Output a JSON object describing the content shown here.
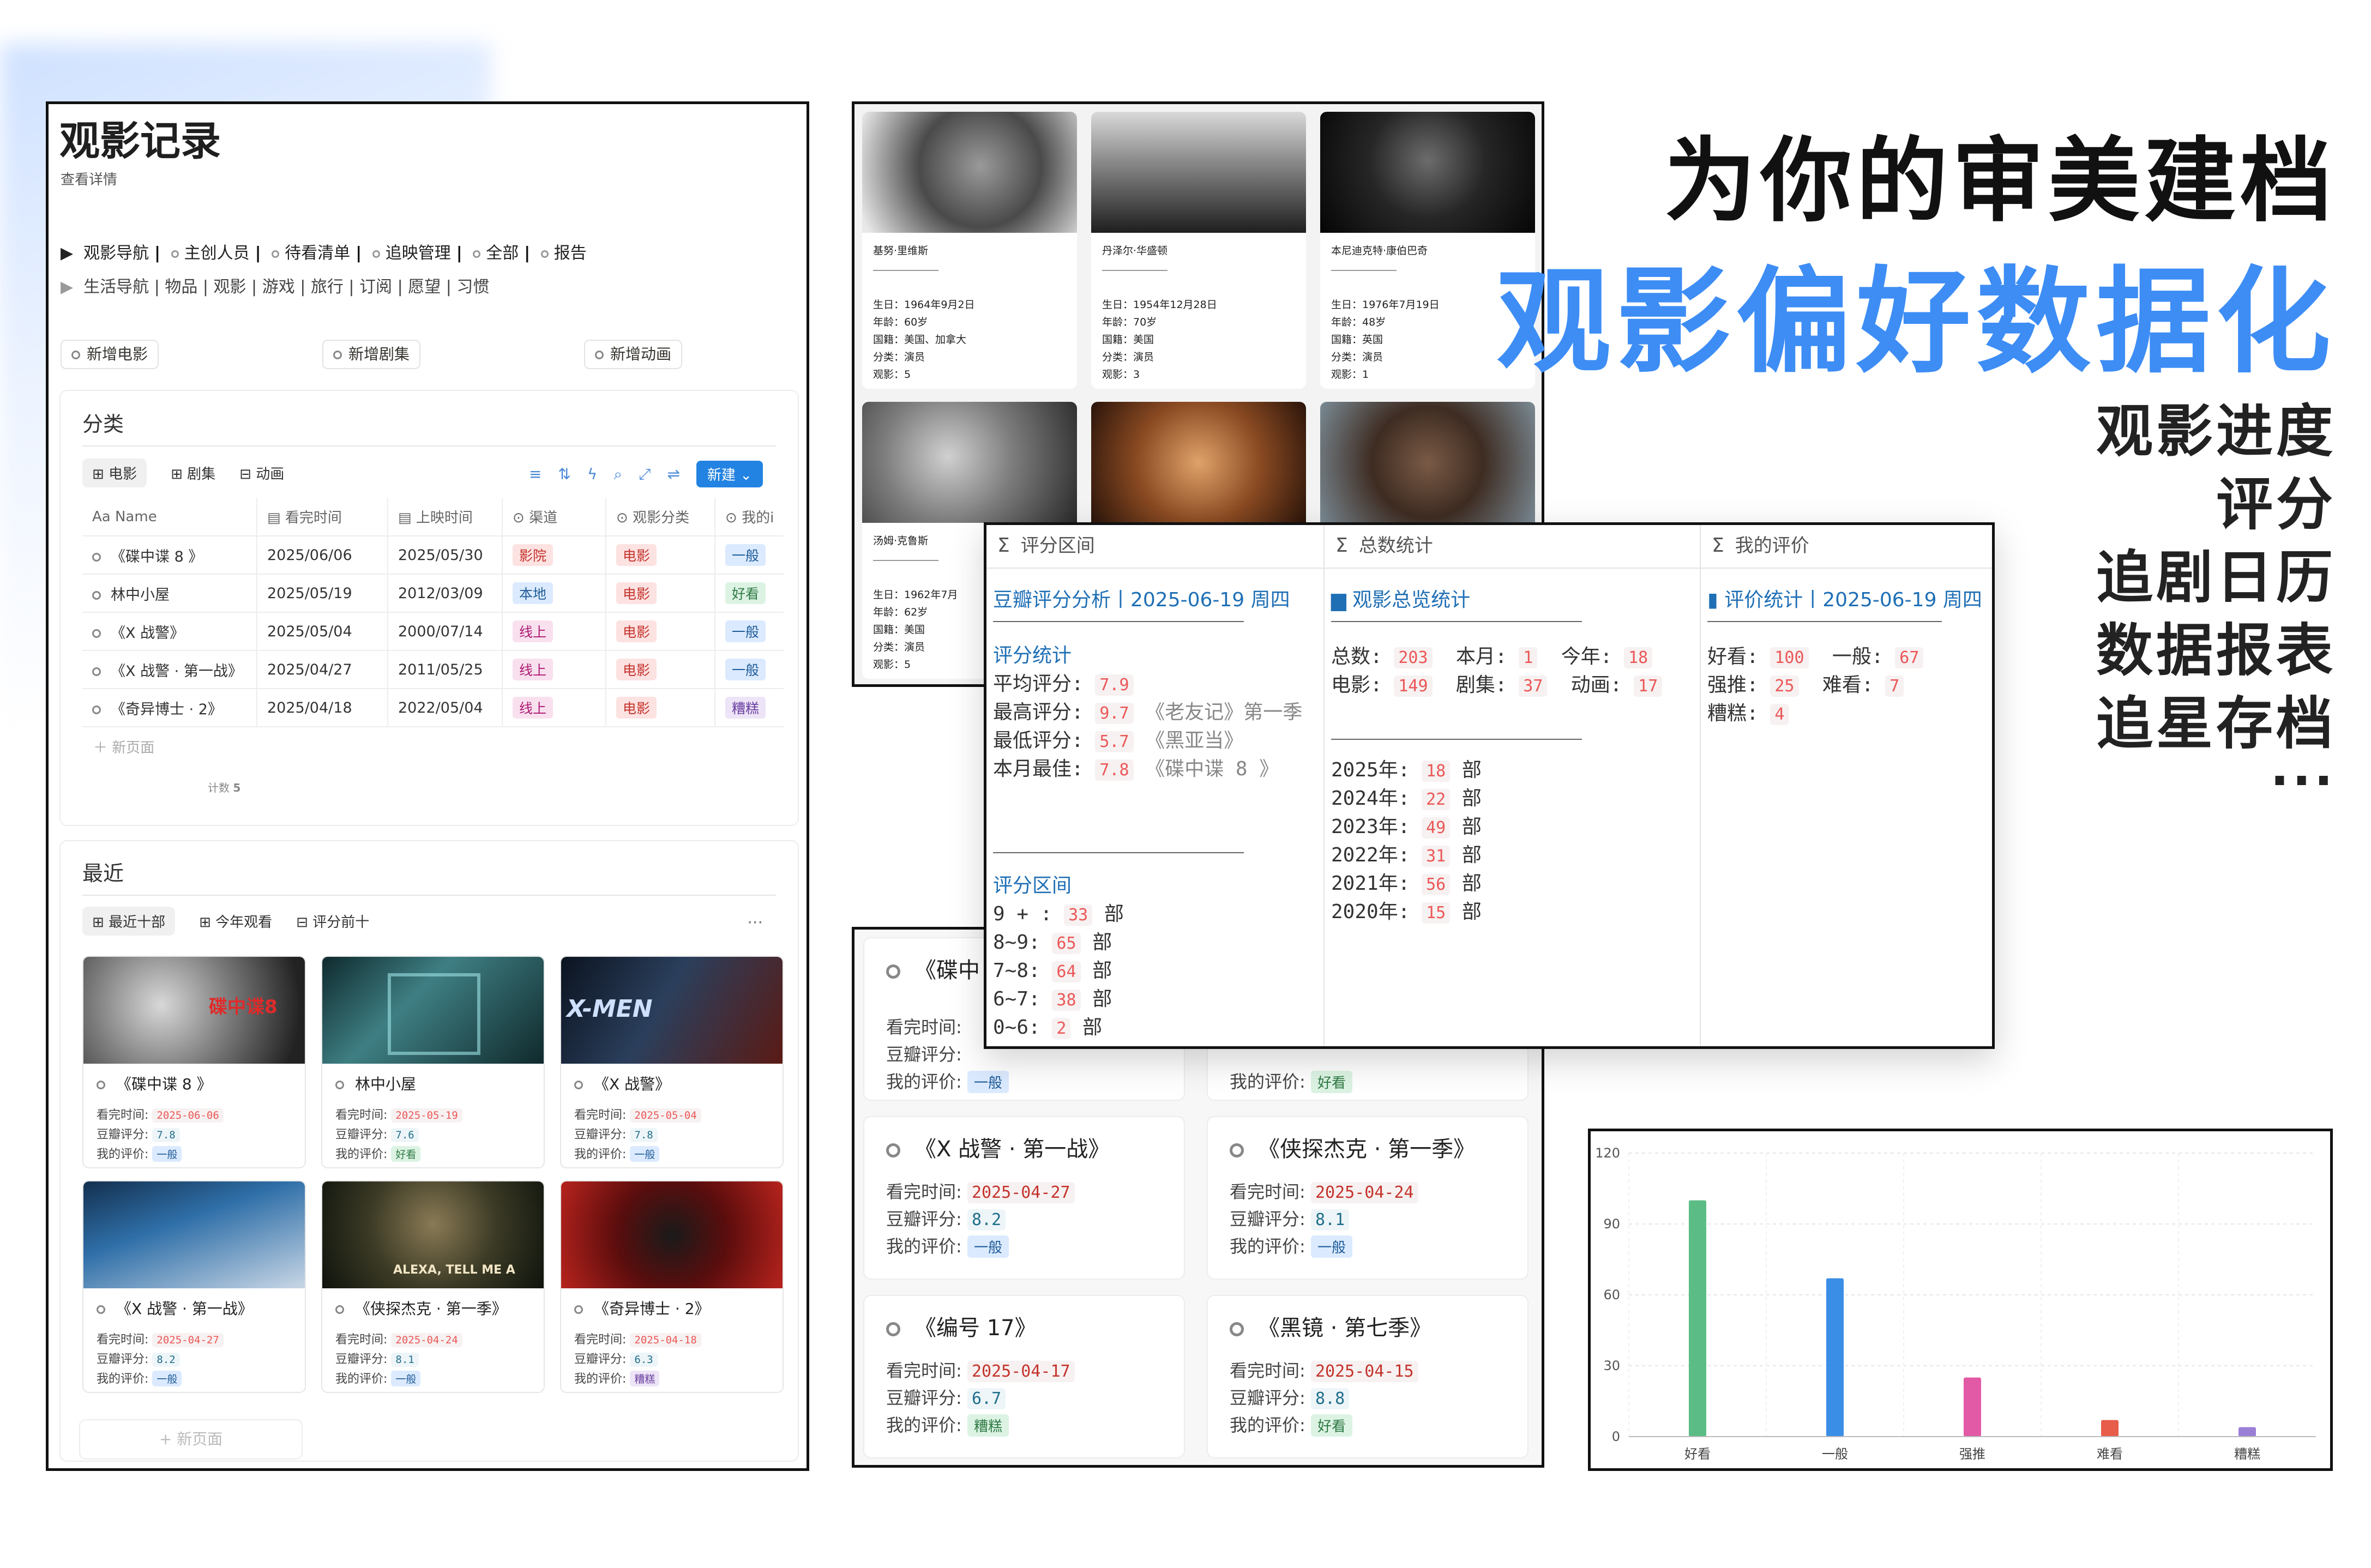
{
  "headline": {
    "line1": "为你的审美建档",
    "line2": "观影偏好数据化"
  },
  "features": [
    "观影进度",
    "评分",
    "追剧日历",
    "数据报表",
    "追星存档",
    "···"
  ],
  "notion_page": {
    "title": "观影记录",
    "subtitle": "查看详情",
    "nav1": [
      "观影导航",
      "主创人员",
      "待看清单",
      "追映管理",
      "全部",
      "报告"
    ],
    "nav2": "生活导航 | 物品 | 观影 | 游戏 | 旅行 | 订阅 | 愿望 | 习惯",
    "buttons": [
      "新增电影",
      "新增剧集",
      "新增动画"
    ],
    "category": {
      "title": "分类",
      "tabs": [
        "电影",
        "剧集",
        "动画"
      ],
      "new_label": "新建",
      "columns": [
        "Name",
        "看完时间",
        "上映时间",
        "渠道",
        "观影分类",
        "我的i"
      ],
      "rows": [
        {
          "name": "《碟中谍 8 》",
          "done": "2025/06/06",
          "release": "2025/05/30",
          "channel": "影院",
          "type": "电影",
          "rating": "一般"
        },
        {
          "name": "林中小屋",
          "done": "2025/05/19",
          "release": "2012/03/09",
          "channel": "本地",
          "type": "电影",
          "rating": "好看"
        },
        {
          "name": "《X 战警》",
          "done": "2025/05/04",
          "release": "2000/07/14",
          "channel": "线上",
          "type": "电影",
          "rating": "一般"
        },
        {
          "name": "《X 战警 · 第一战》",
          "done": "2025/04/27",
          "release": "2011/05/25",
          "channel": "线上",
          "type": "电影",
          "rating": "一般"
        },
        {
          "name": "《奇异博士 · 2》",
          "done": "2025/04/18",
          "release": "2022/05/04",
          "channel": "线上",
          "type": "电影",
          "rating": "糟糕"
        }
      ],
      "new_page": "新页面",
      "count_label": "计数",
      "count": "5"
    },
    "recent": {
      "title": "最近",
      "tabs": [
        "最近十部",
        "今年观看",
        "评分前十"
      ],
      "more": "···",
      "field_labels": [
        "看完时间:",
        "豆瓣评分:",
        "我的评价:"
      ],
      "cards": [
        {
          "title": "《碟中谍 8 》",
          "done": "2025-06-06",
          "score": "7.8",
          "rating": "一般"
        },
        {
          "title": "林中小屋",
          "done": "2025-05-19",
          "score": "7.6",
          "rating": "好看"
        },
        {
          "title": "《X 战警》",
          "done": "2025-05-04",
          "score": "7.8",
          "rating": "一般"
        },
        {
          "title": "《X 战警 · 第一战》",
          "done": "2025-04-27",
          "score": "8.2",
          "rating": "一般"
        },
        {
          "title": "《侠探杰克 · 第一季》",
          "done": "2025-04-24",
          "score": "8.1",
          "rating": "一般"
        },
        {
          "title": "《奇异博士 · 2》",
          "done": "2025-04-18",
          "score": "6.3",
          "rating": "糟糕"
        }
      ],
      "new_page": "+ 新页面"
    }
  },
  "people": [
    {
      "name": "基努·里维斯",
      "birth": "生日：1964年9月2日",
      "age": "年龄：60岁",
      "nation": "国籍：美国、加拿大",
      "cat": "分类：演员",
      "films": "观影：5"
    },
    {
      "name": "丹泽尔·华盛顿",
      "birth": "生日：1954年12月28日",
      "age": "年龄：70岁",
      "nation": "国籍：美国",
      "cat": "分类：演员",
      "films": "观影：3"
    },
    {
      "name": "本尼迪克特·康伯巴奇",
      "birth": "生日：1976年7月19日",
      "age": "年龄：48岁",
      "nation": "国籍：英国",
      "cat": "分类：演员",
      "films": "观影：1"
    },
    {
      "name": "汤姆·克鲁斯",
      "birth": "生日：1962年7月",
      "age": "年龄：62岁",
      "nation": "国籍：美国",
      "cat": "分类：演员",
      "films": "观影：5"
    }
  ],
  "poster_text": {
    "mi8": "碟中谍8",
    "xmen": "X-MEN",
    "alexa": "ALEXA, TELL ME A"
  },
  "watch_cards": {
    "labels": [
      "看完时间:",
      "豆瓣评分:",
      "我的评价:"
    ],
    "partial": [
      {
        "title": "《碟中",
        "rating": "一般"
      },
      {
        "rating": "好看"
      }
    ],
    "items": [
      {
        "title": "《X 战警 · 第一战》",
        "done": "2025-04-27",
        "score": "8.2",
        "rating": "一般"
      },
      {
        "title": "《侠探杰克 · 第一季》",
        "done": "2025-04-24",
        "score": "8.1",
        "rating": "一般"
      },
      {
        "title": "《编号 17》",
        "done": "2025-04-17",
        "score": "6.7",
        "rating": "糟糕"
      },
      {
        "title": "《黑镜 · 第七季》",
        "done": "2025-04-15",
        "score": "8.8",
        "rating": "好看"
      }
    ]
  },
  "stats": {
    "col_headers": [
      "评分区间",
      "总数统计",
      "我的评价"
    ],
    "col1": {
      "head": "豆瓣评分分析丨2025-06-19 周四",
      "sub": "评分统计",
      "avg_label": "平均评分:",
      "avg": "7.9",
      "max_label": "最高评分:",
      "max": "9.7",
      "max_title": "《老友记》第一季",
      "min_label": "最低评分:",
      "min": "5.7",
      "min_title": "《黑亚当》",
      "best_label": "本月最佳:",
      "best": "7.8",
      "best_title": "《碟中谍 8 》",
      "range_head": "评分区间",
      "unit": "部",
      "ranges": [
        {
          "label": "9 + :",
          "n": "33"
        },
        {
          "label": "8~9:",
          "n": "65"
        },
        {
          "label": "7~8:",
          "n": "64"
        },
        {
          "label": "6~7:",
          "n": "38"
        },
        {
          "label": "0~6:",
          "n": "2"
        }
      ]
    },
    "col2": {
      "head": "观影总览统计",
      "total_label": "总数:",
      "total": "203",
      "month_label": "本月:",
      "month": "1",
      "year_label": "今年:",
      "year": "18",
      "movie_label": "电影:",
      "movie": "149",
      "series_label": "剧集:",
      "series": "37",
      "anime_label": "动画:",
      "anime": "17",
      "unit": "部",
      "years": [
        {
          "label": "2025年:",
          "n": "18"
        },
        {
          "label": "2024年:",
          "n": "22"
        },
        {
          "label": "2023年:",
          "n": "49"
        },
        {
          "label": "2022年:",
          "n": "31"
        },
        {
          "label": "2021年:",
          "n": "56"
        },
        {
          "label": "2020年:",
          "n": "15"
        }
      ]
    },
    "col3": {
      "head": "评价统计丨2025-06-19 周四",
      "good_label": "好看:",
      "good": "100",
      "ok_label": "一般:",
      "ok": "67",
      "rec_label": "强推:",
      "rec": "25",
      "bad_label": "难看:",
      "bad": "7",
      "awful_label": "糟糕:",
      "awful": "4"
    }
  },
  "chart_data": {
    "type": "bar",
    "categories": [
      "好看",
      "一般",
      "强推",
      "难看",
      "糟糕"
    ],
    "values": [
      100,
      67,
      25,
      7,
      4
    ],
    "colors": [
      "#5bbd85",
      "#3a8ee6",
      "#e25aa5",
      "#e85c4a",
      "#9a7fd6"
    ],
    "ylim": [
      0,
      120
    ],
    "yticks": [
      0,
      30,
      60,
      90,
      120
    ],
    "grid": true
  }
}
